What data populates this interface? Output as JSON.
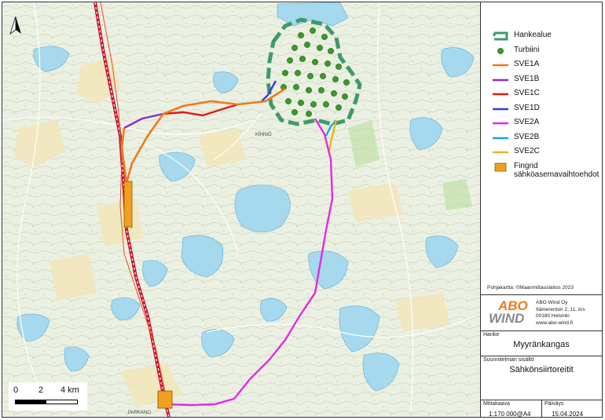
{
  "map": {
    "north_label": "N",
    "town_label_1": "KIHNIÖ",
    "town_label_2": "PARKANO",
    "scale": {
      "ticks": [
        "0",
        "2",
        "4 km"
      ]
    }
  },
  "legend": {
    "items": [
      {
        "key": "hankealue",
        "label": "Hankealue",
        "symbol": "area-outline",
        "color": "#3f9a6a"
      },
      {
        "key": "turbiini",
        "label": "Turbiini",
        "symbol": "dot",
        "color": "#3a9a2a"
      },
      {
        "key": "sve1a",
        "label": "SVE1A",
        "symbol": "line",
        "color": "#f07a1a"
      },
      {
        "key": "sve1b",
        "label": "SVE1B",
        "symbol": "line",
        "color": "#8a2ad8"
      },
      {
        "key": "sve1c",
        "label": "SVE1C",
        "symbol": "line",
        "color": "#e01818"
      },
      {
        "key": "sve1d",
        "label": "SVE1D",
        "symbol": "line",
        "color": "#3a3ae0"
      },
      {
        "key": "sve2a",
        "label": "SVE2A",
        "symbol": "line",
        "color": "#e628e6"
      },
      {
        "key": "sve2b",
        "label": "SVE2B",
        "symbol": "line",
        "color": "#18a8d8"
      },
      {
        "key": "sve2c",
        "label": "SVE2C",
        "symbol": "line",
        "color": "#e8b818"
      },
      {
        "key": "fingrid",
        "label": "Fingrid sähköasemavaihtoehdot",
        "symbol": "box",
        "color": "#f0a020"
      }
    ],
    "credit": "Pohjakartta: ©Maanmittauslaitos 2023"
  },
  "company": {
    "logo_top": "ABO",
    "logo_bottom": "WIND",
    "address_lines": [
      "ABO Wind Oy",
      "Itämerentori 2, 11. krs",
      "00180 Helsinki",
      "www.abo-wind.fi"
    ]
  },
  "title_block": {
    "hanke_label": "Hanke",
    "hanke_value": "Myyränkangas",
    "content_label": "Suunnitelman sisältö",
    "content_value": "Sähkönsiirtoreitit",
    "scale_label": "Mittakaava",
    "scale_value": "1:170 000@A4",
    "date_label": "Päiväys",
    "date_value": "15.04.2024"
  }
}
